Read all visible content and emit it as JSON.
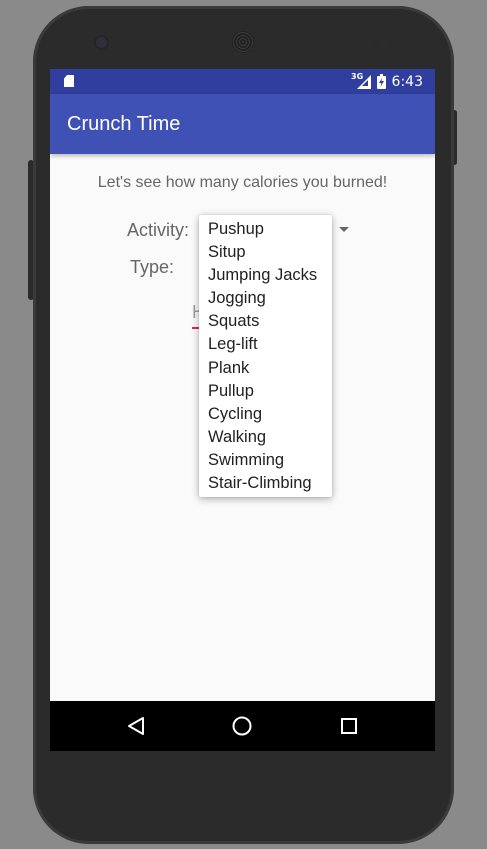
{
  "status_bar": {
    "network_label": "3G",
    "time": "6:43"
  },
  "app_bar": {
    "title": "Crunch Time"
  },
  "main": {
    "intro_text": "Let's see how many calories you burned!",
    "activity_label": "Activity:",
    "type_label": "Type:",
    "hours_input_value": "H"
  },
  "activity_dropdown": {
    "options": [
      "Pushup",
      "Situp",
      "Jumping Jacks",
      "Jogging",
      "Squats",
      "Leg-lift",
      "Plank",
      "Pullup",
      "Cycling",
      "Walking",
      "Swimming",
      "Stair-Climbing"
    ]
  },
  "colors": {
    "status_bar": "#303f9f",
    "app_bar": "#3f51b5",
    "input_underline": "#e91e63"
  }
}
